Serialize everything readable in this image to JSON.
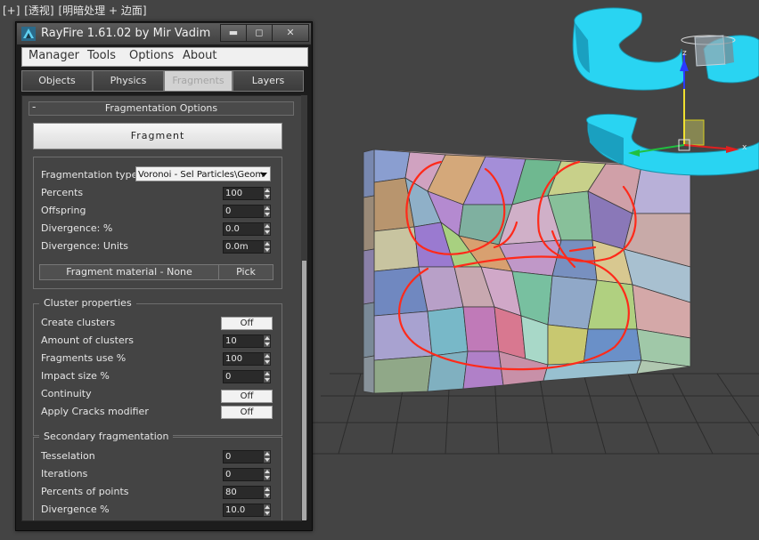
{
  "viewport": {
    "label_parts": [
      "[+]",
      "[透视]",
      "[明暗处理 + 边面]"
    ],
    "background": "#444444"
  },
  "window": {
    "title": "RayFire 1.61.02  by Mir Vadim",
    "min_glyph": "▬",
    "max_glyph": "◻",
    "close_glyph": "✕"
  },
  "menu": [
    "Manager",
    "Tools",
    "Options",
    "About"
  ],
  "tabs": [
    "Objects",
    "Physics",
    "Fragments",
    "Layers"
  ],
  "active_tab": "Fragments",
  "rollout": {
    "toggle": "-",
    "title": "Fragmentation Options"
  },
  "fragment_button": "Fragment",
  "fragmentation": {
    "type_label": "Fragmentation type",
    "type_value": "Voronoi - Sel Particles\\Geom",
    "rows": [
      {
        "label": "Percents",
        "value": "100"
      },
      {
        "label": "Offspring",
        "value": "0"
      },
      {
        "label": "Divergence: %",
        "value": "0.0"
      },
      {
        "label": "Divergence: Units",
        "value": "0.0m"
      }
    ],
    "material_button": "Fragment material - None",
    "pick_button": "Pick"
  },
  "cluster": {
    "title": "Cluster properties",
    "rows": [
      {
        "label": "Create clusters",
        "kind": "toggle",
        "value": "Off"
      },
      {
        "label": "Amount of clusters",
        "kind": "spinner",
        "value": "10"
      },
      {
        "label": "Fragments use %",
        "kind": "spinner",
        "value": "100"
      },
      {
        "label": "Impact size %",
        "kind": "spinner",
        "value": "0"
      },
      {
        "label": "Continuity",
        "kind": "toggle",
        "value": "Off"
      },
      {
        "label": "Apply Cracks modifier",
        "kind": "toggle",
        "value": "Off"
      }
    ]
  },
  "secondary": {
    "title": "Secondary fragmentation",
    "rows": [
      {
        "label": "Tesselation",
        "value": "0"
      },
      {
        "label": "Iterations",
        "value": "0"
      },
      {
        "label": "Percents of points",
        "value": "80"
      },
      {
        "label": "Divergence %",
        "value": "10.0"
      }
    ]
  },
  "scene": {
    "gizmo_axis_x": "x",
    "gizmo_axis_z": "z",
    "colors": {
      "wall_edge": "#6a6a6a",
      "torus": "#29d4f2",
      "annotation": "#ff2a1a"
    }
  }
}
